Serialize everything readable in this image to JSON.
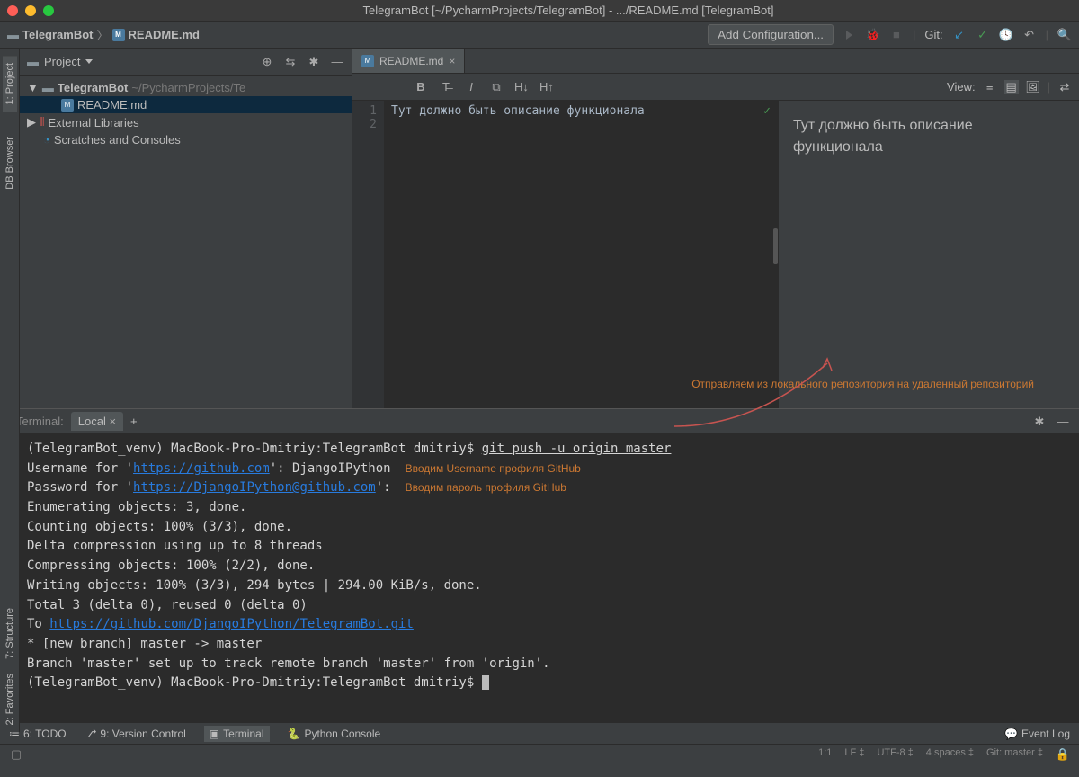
{
  "title": "TelegramBot [~/PycharmProjects/TelegramBot] - .../README.md [TelegramBot]",
  "breadcrumb": {
    "root": "TelegramBot",
    "file": "README.md"
  },
  "nav": {
    "addConfig": "Add Configuration...",
    "gitLabel": "Git:"
  },
  "leftRail": {
    "project": "1: Project",
    "db": "DB Browser"
  },
  "leftRail2": {
    "structure": "7: Structure",
    "favorites": "2: Favorites"
  },
  "projPanel": {
    "label": "Project",
    "root": "TelegramBot",
    "rootPath": "~/PycharmProjects/Te",
    "items": [
      "README.md",
      "External Libraries",
      "Scratches and Consoles"
    ]
  },
  "editor": {
    "tab": "README.md",
    "line1": "1",
    "line2": "2",
    "code": "Тут должно быть описание функционала",
    "preview": "Тут должно быть описание функционала",
    "viewLabel": "View:",
    "annotation": "Отправляем из локального репозитория на удаленный репозиторий"
  },
  "terminal": {
    "label": "Terminal:",
    "tab": "Local",
    "prompt1": "(TelegramBot_venv) MacBook-Pro-Dmitriy:TelegramBot dmitriy$ ",
    "cmd": "git push -u origin master",
    "l2a": "Username for '",
    "l2b": "https://github.com",
    "l2c": "': DjangoIPython",
    "note1": "Вводим Username профиля GitHub",
    "l3a": "Password for '",
    "l3b": "https://DjangoIPython@github.com",
    "l3c": "':",
    "note2": "Вводим пароль профиля GitHub",
    "l4": "Enumerating objects: 3, done.",
    "l5": "Counting objects: 100% (3/3), done.",
    "l6": "Delta compression using up to 8 threads",
    "l7": "Compressing objects: 100% (2/2), done.",
    "l8": "Writing objects: 100% (3/3), 294 bytes | 294.00 KiB/s, done.",
    "l9": "Total 3 (delta 0), reused 0 (delta 0)",
    "l10a": "To ",
    "l10b": "https://github.com/DjangoIPython/TelegramBot.git",
    "l11": " * [new branch]      master -> master",
    "l12": "Branch 'master' set up to track remote branch 'master' from 'origin'.",
    "prompt2": "(TelegramBot_venv) MacBook-Pro-Dmitriy:TelegramBot dmitriy$ "
  },
  "bottomRail": {
    "todo": "6: TODO",
    "vcs": "9: Version Control",
    "terminal": "Terminal",
    "python": "Python Console",
    "eventLog": "Event Log"
  },
  "status": {
    "pos": "1:1",
    "le": "LF",
    "enc": "UTF-8",
    "indent": "4 spaces",
    "git": "Git: master"
  }
}
